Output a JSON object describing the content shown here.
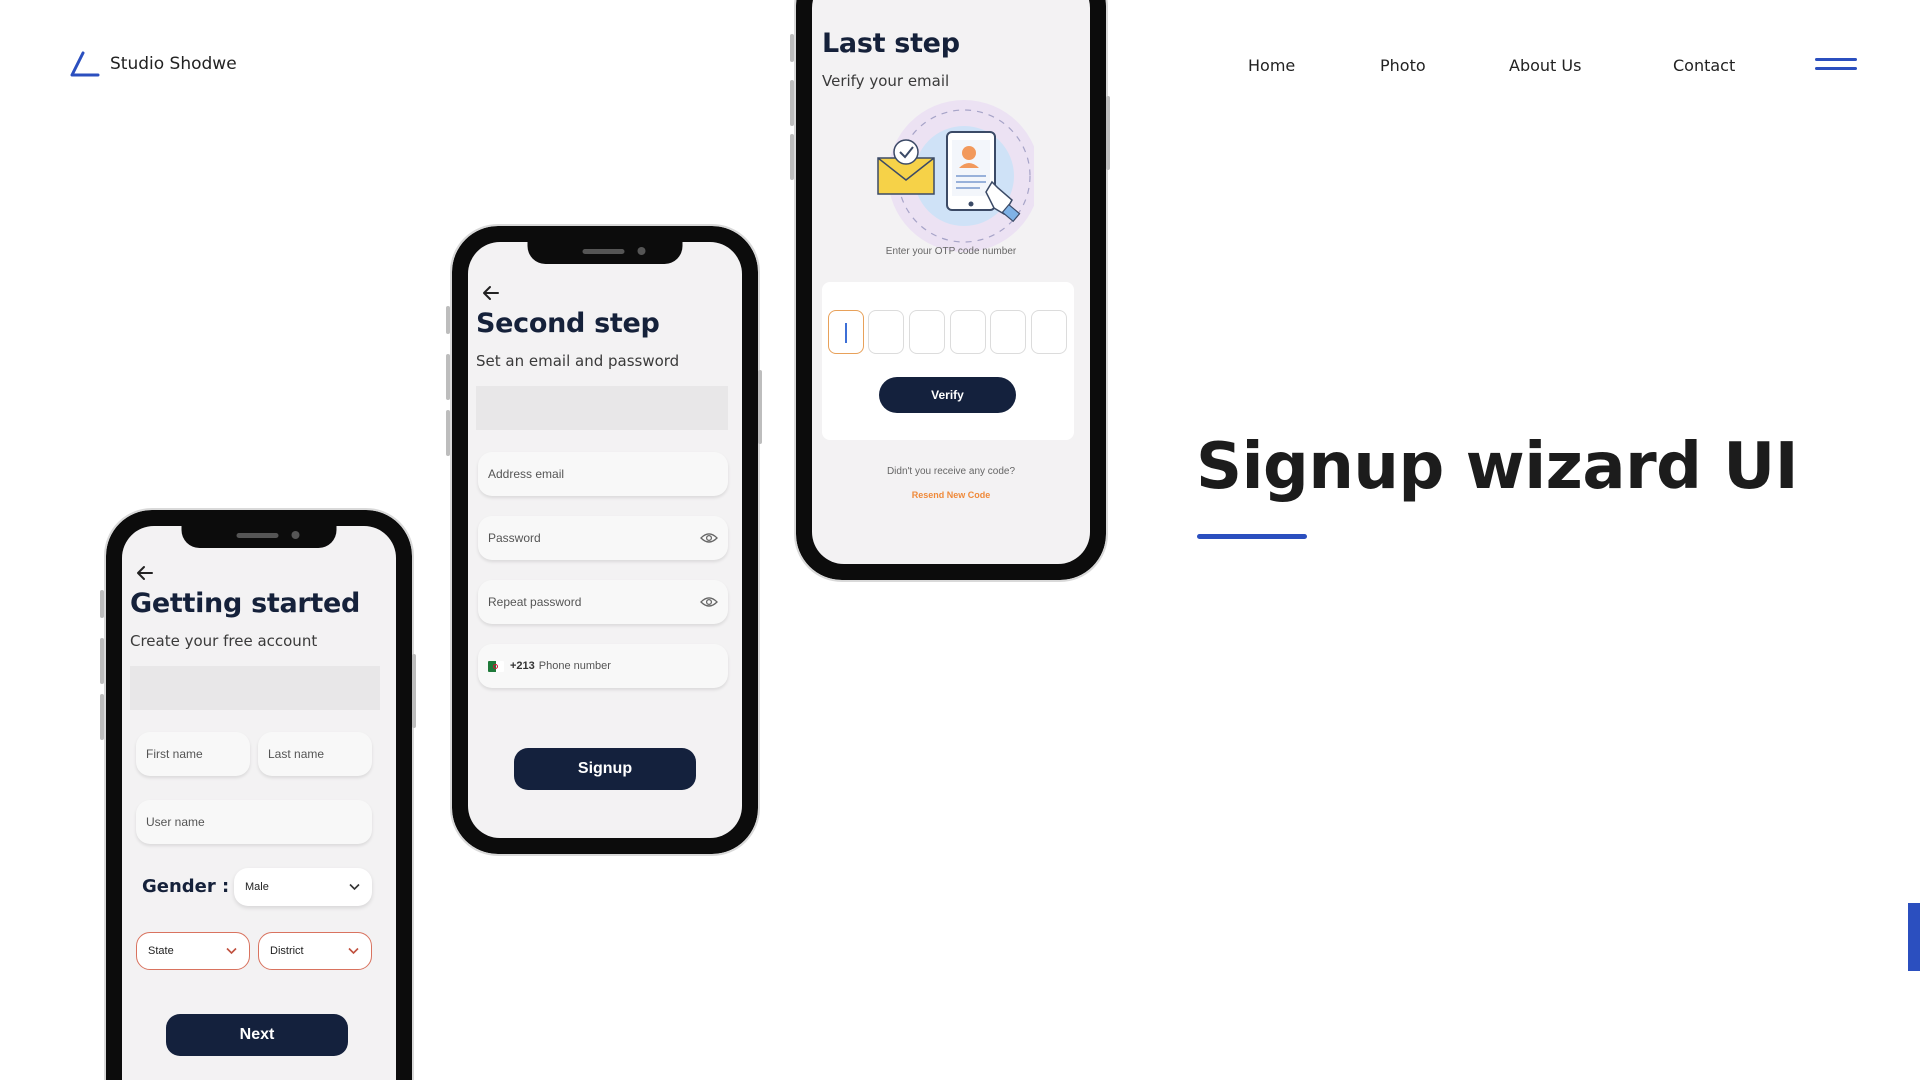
{
  "brand": {
    "name": "Studio Shodwe",
    "logo_icon": "triangle-logo-icon"
  },
  "nav": {
    "links": [
      "Home",
      "Photo",
      "About Us",
      "Contact"
    ],
    "menu_icon": "hamburger-menu-icon"
  },
  "hero": {
    "title": "Signup wizard UI"
  },
  "colors": {
    "accent": "#2b4fbf",
    "button_dark": "#14213d",
    "otp_orange": "#ef8a3a",
    "select_border": "#d9735f"
  },
  "phone1": {
    "title": "Getting started",
    "subtitle": "Create your free account",
    "first_name_placeholder": "First name",
    "last_name_placeholder": "Last name",
    "username_placeholder": "User name",
    "gender_label": "Gender :",
    "gender_value": "Male",
    "state_value": "State",
    "district_value": "District",
    "next_label": "Next"
  },
  "phone2": {
    "title": "Second step",
    "subtitle": "Set an email and password",
    "email_placeholder": "Address email",
    "password_placeholder": "Password",
    "repeat_password_placeholder": "Repeat password",
    "phone_code": "+213",
    "phone_placeholder": "Phone number",
    "signup_label": "Signup"
  },
  "phone3": {
    "title": "Last step",
    "subtitle": "Verify your email",
    "otp_prompt": "Enter your OTP code number",
    "verify_label": "Verify",
    "no_code_text": "Didn't you receive any code?",
    "resend_label": "Resend New Code"
  }
}
